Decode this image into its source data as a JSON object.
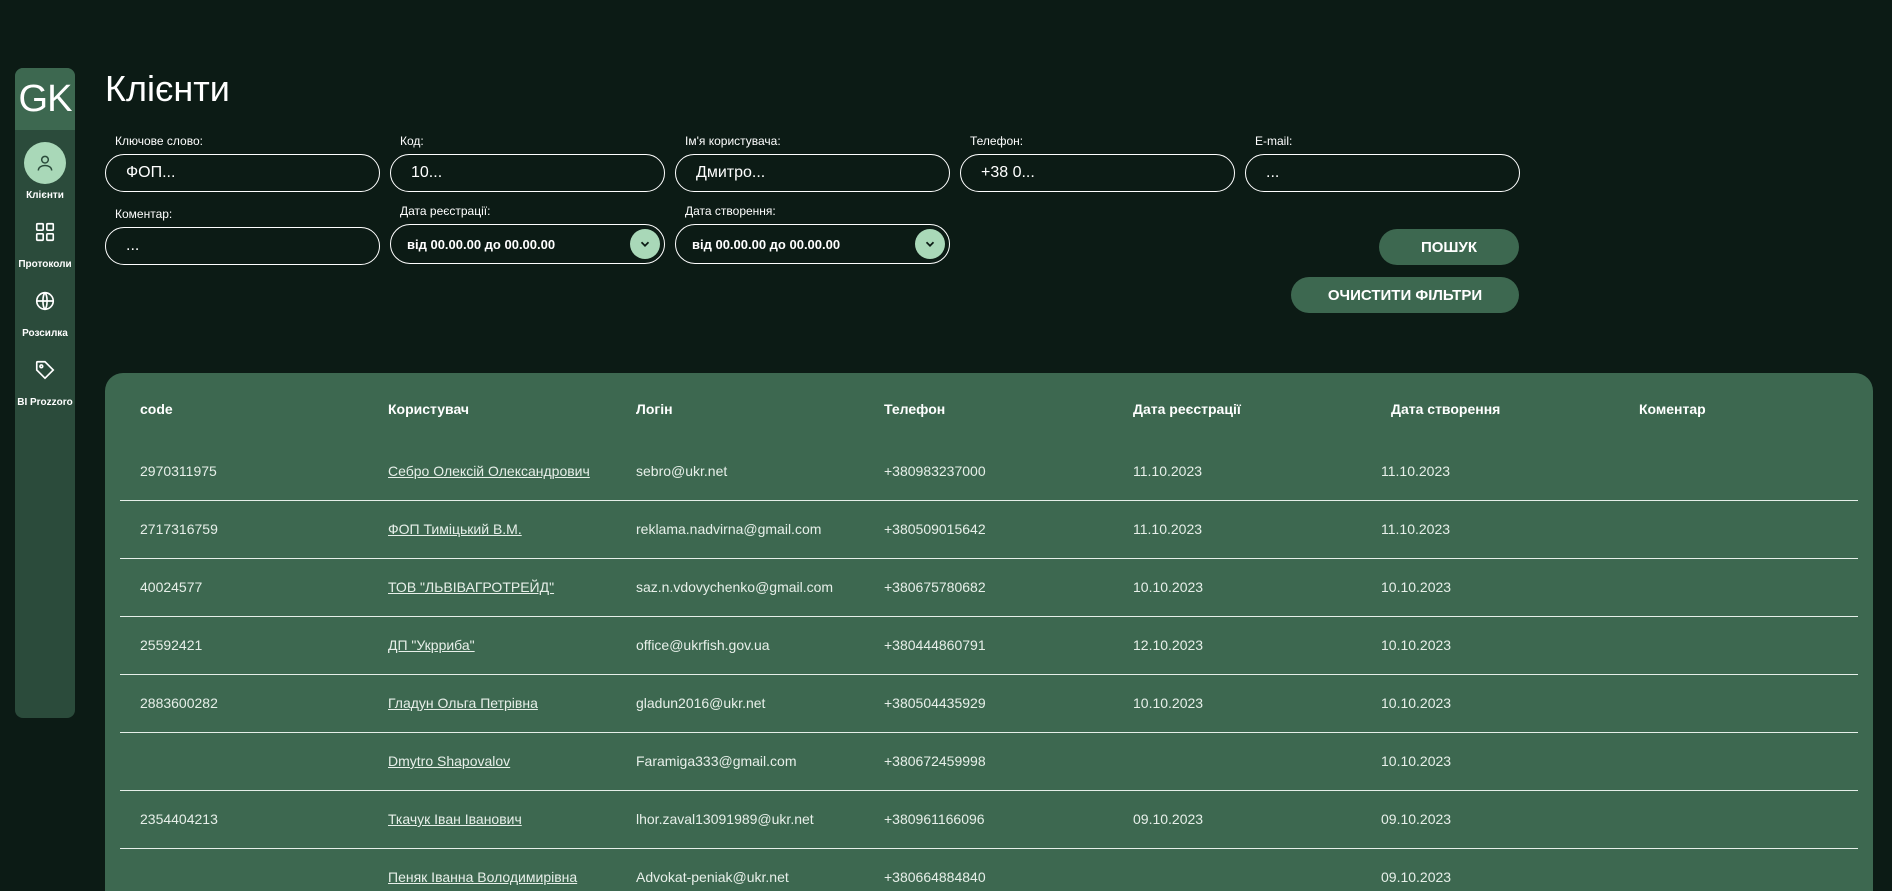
{
  "sidebar": {
    "logo": "GK",
    "items": [
      {
        "label": "Клієнти",
        "icon": "user-icon",
        "active": true
      },
      {
        "label": "Протоколи",
        "icon": "grid-icon",
        "active": false
      },
      {
        "label": "Розсилка",
        "icon": "globe-icon",
        "active": false
      },
      {
        "label": "BI Prozzoro",
        "icon": "tag-icon",
        "active": false
      }
    ]
  },
  "page": {
    "title": "Клієнти"
  },
  "filters": {
    "keyword": {
      "label": "Ключове слово:",
      "placeholder": "ФОП..."
    },
    "code": {
      "label": "Код:",
      "placeholder": "10..."
    },
    "username": {
      "label": "Ім'я користувача:",
      "placeholder": "Дмитро..."
    },
    "phone": {
      "label": "Телефон:",
      "placeholder": "+38 0..."
    },
    "email": {
      "label": "E-mail:",
      "placeholder": "..."
    },
    "comment": {
      "label": "Коментар:",
      "placeholder": "..."
    },
    "reg_date": {
      "label": "Дата реєстрації:",
      "value": "від 00.00.00 до 00.00.00"
    },
    "create_date": {
      "label": "Дата створення:",
      "value": "від 00.00.00 до 00.00.00"
    },
    "search_button": "ПОШУК",
    "clear_button": "ОЧИСТИТИ ФІЛЬТРИ"
  },
  "table": {
    "headers": [
      "code",
      "Користувач",
      "Логін",
      "Телефон",
      "Дата реєстрації",
      "Дата створення",
      "Коментар"
    ],
    "rows": [
      {
        "code": "2970311975",
        "user": "Себро Олексій Олександрович",
        "login": "sebro@ukr.net",
        "phone": "+380983237000",
        "reg": "11.10.2023",
        "created": "11.10.2023",
        "comment": ""
      },
      {
        "code": "2717316759",
        "user": "ФОП Тиміцький В.М.",
        "login": "reklama.nadvirna@gmail.com",
        "phone": "+380509015642",
        "reg": "11.10.2023",
        "created": "11.10.2023",
        "comment": ""
      },
      {
        "code": "40024577",
        "user": "ТОВ \"ЛЬВІВАГРОТРЕЙД\"",
        "login": "saz.n.vdovychenko@gmail.com",
        "phone": "+380675780682",
        "reg": "10.10.2023",
        "created": "10.10.2023",
        "comment": ""
      },
      {
        "code": "25592421",
        "user": "ДП \"Укрриба\"",
        "login": "office@ukrfish.gov.ua",
        "phone": "+380444860791",
        "reg": "12.10.2023",
        "created": "10.10.2023",
        "comment": ""
      },
      {
        "code": "2883600282",
        "user": "Гладун Ольга Петрівна",
        "login": "gladun2016@ukr.net",
        "phone": "+380504435929",
        "reg": "10.10.2023",
        "created": "10.10.2023",
        "comment": ""
      },
      {
        "code": "",
        "user": "Dmytro Shapovalov",
        "login": "Faramiga333@gmail.com",
        "phone": "+380672459998",
        "reg": "",
        "created": "10.10.2023",
        "comment": ""
      },
      {
        "code": "2354404213",
        "user": "Ткачук Іван Іванович",
        "login": "lhor.zaval13091989@ukr.net",
        "phone": "+380961166096",
        "reg": "09.10.2023",
        "created": "09.10.2023",
        "comment": ""
      },
      {
        "code": "",
        "user": "Пеняк Іванна Володимирівна",
        "login": "Advokat-peniak@ukr.net",
        "phone": "+380664884840",
        "reg": "",
        "created": "09.10.2023",
        "comment": ""
      }
    ]
  },
  "colors": {
    "background": "#0c1b15",
    "panel": "#3d6850",
    "sidebar": "#2b4b3b",
    "accent": "#a9d8b8"
  }
}
